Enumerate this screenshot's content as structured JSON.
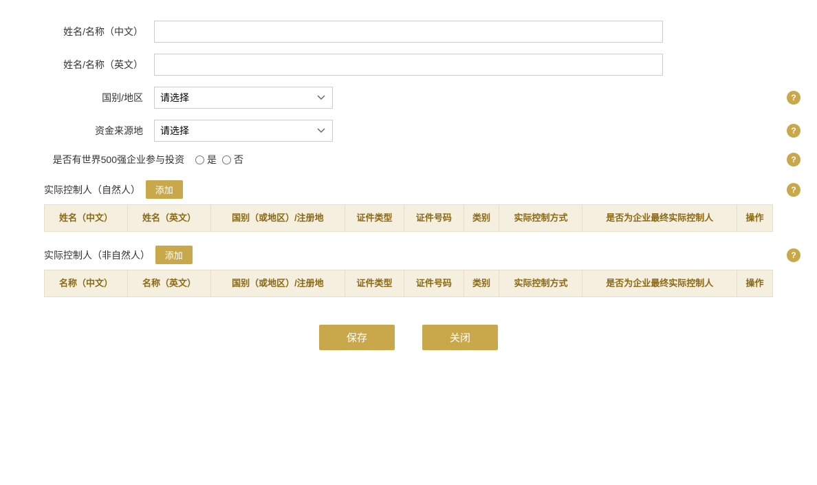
{
  "form": {
    "name_cn_label": "姓名/名称（中文）",
    "name_en_label": "姓名/名称（英文）",
    "country_label": "国别/地区",
    "fund_source_label": "资金来源地",
    "fortune500_label": "是否有世界500强企业参与投资",
    "yes_label": "是",
    "no_label": "否",
    "country_placeholder": "请选择",
    "fund_source_placeholder": "请选择"
  },
  "natural_person_section": {
    "title": "实际控制人（自然人）",
    "add_label": "添加",
    "columns": [
      "姓名（中文）",
      "姓名（英文）",
      "国别（或地区）/注册地",
      "证件类型",
      "证件号码",
      "类别",
      "实际控制方式",
      "是否为企业最终实际控制人",
      "操作"
    ]
  },
  "non_natural_person_section": {
    "title": "实际控制人（非自然人）",
    "add_label": "添加",
    "columns": [
      "名称（中文）",
      "名称（英文）",
      "国别（或地区）/注册地",
      "证件类型",
      "证件号码",
      "类别",
      "实际控制方式",
      "是否为企业最终实际控制人",
      "操作"
    ]
  },
  "buttons": {
    "save_label": "保存",
    "close_label": "关闭"
  },
  "help_icon": "?",
  "colors": {
    "gold": "#c9a84c",
    "table_header_bg": "#f5efe0",
    "table_header_text": "#8b6914"
  }
}
